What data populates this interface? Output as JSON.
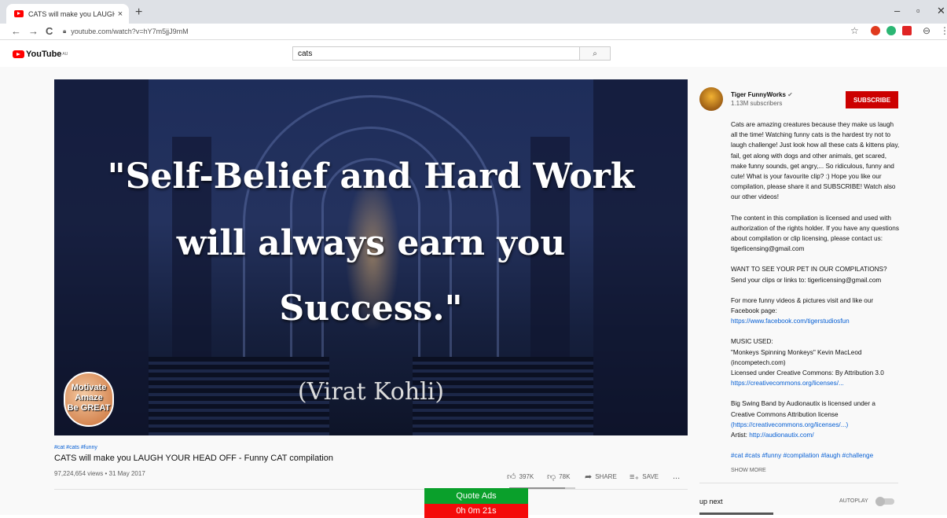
{
  "browser": {
    "tab_title": "CATS will make you LAUGH YOU",
    "tab_close": "×",
    "new_tab": "+",
    "url": "youtube.com/watch?v=hY7m5jjJ9mM",
    "nav_back": "←",
    "nav_forward": "→",
    "nav_reload": "C",
    "bookmark_star": "☆",
    "profile": "⊖",
    "menu": "⋮",
    "win_min": "–",
    "win_max": "▫",
    "win_close": "✕"
  },
  "youtube": {
    "logo_text": "YouTube",
    "region": "AU",
    "search_value": "cats",
    "search_icon": "⌕"
  },
  "video": {
    "quote_lines": [
      "\"Self-Belief and Hard Work",
      "will always earn you",
      "Success.\""
    ],
    "author": "(Virat Kohli)",
    "badge_lines": [
      "Motivate",
      "Amaze",
      "Be GREAT"
    ],
    "tags": "#cat #cats #funny",
    "title": "CATS will make you LAUGH YOUR HEAD OFF - Funny CAT compilation",
    "views": "97,224,654 views • 31 May 2017",
    "likes": "397K",
    "dislikes": "78K",
    "like_ratio": 0.84,
    "share_label": "SHARE",
    "save_label": "SAVE",
    "more": "..."
  },
  "overlay": {
    "quote_ads": "Quote Ads",
    "timer": "0h 0m 21s",
    "colors": {
      "ads": "#0aa02b",
      "timer": "#f40a0a"
    }
  },
  "channel": {
    "name": "Tiger FunnyWorks",
    "verified": "✔",
    "subscribers": "1.13M subscribers",
    "subscribe_label": "SUBSCRIBE",
    "accent": "#cc0000"
  },
  "description": {
    "p1": "Cats are amazing creatures because they make us laugh all the time! Watching funny cats is the hardest try not to laugh challenge! Just look how all these cats & kittens play, fail, get along with dogs and other animals, get scared, make funny sounds, get angry,... So ridiculous, funny and cute! What is your favourite clip? :) Hope you like our compilation, please share it and SUBSCRIBE! Watch also our other videos!",
    "p2": "The content in this compilation is licensed and used with authorization of the rights holder. If you have any questions about compilation or clip licensing, please contact us: tigerlicensing@gmail.com",
    "p3": "WANT TO SEE YOUR PET IN OUR COMPILATIONS? Send your clips or links to: tigerlicensing@gmail.com",
    "p4": "For more funny videos & pictures visit and like our Facebook page:",
    "p4_link": "https://www.facebook.com/tigerstudiosfun",
    "p5_title": "MUSIC USED:",
    "p5_l1": "\"Monkeys Spinning Monkeys\" Kevin MacLeod (incompetech.com)",
    "p5_l2": "Licensed under Creative Commons: By Attribution 3.0",
    "p5_link": "https://creativecommons.org/licenses/...",
    "p6_l1": "Big Swing Band by Audionautix is licensed under a Creative Commons Attribution license",
    "p6_link": "(https://creativecommons.org/licenses/...)",
    "p6_artist": "Artist:",
    "p6_artist_link": "http://audionautix.com/",
    "hashtags": "#cat #cats #funny #compilation #laugh #challenge",
    "show_more": "SHOW MORE"
  },
  "sidebar": {
    "up_next": "up next",
    "autoplay": "AUTOPLAY"
  },
  "icons": {
    "like": "thumbs-up-icon",
    "dislike": "thumbs-down-icon",
    "share": "share-icon",
    "save": "save-to-playlist-icon"
  }
}
